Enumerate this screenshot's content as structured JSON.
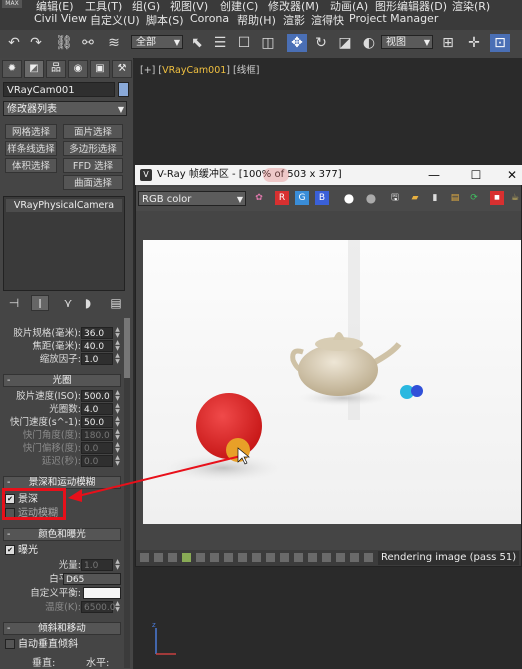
{
  "menubar": {
    "logo": "MAX",
    "row1": [
      "编辑(E)",
      "工具(T)",
      "组(G)",
      "视图(V)",
      "创建(C)",
      "修改器(M)",
      "动画(A)",
      "图形编辑器(D)",
      "渲染(R)"
    ],
    "row2": [
      "Civil View",
      "自定义(U)",
      "脚本(S)",
      "Corona",
      "帮助(H)",
      "渲影",
      "渲得快",
      "Project Manager"
    ]
  },
  "toolbar": {
    "filter_value": "全部",
    "view_value": "视图"
  },
  "panel": {
    "object_name": "VRayCam001",
    "modifier_list": "修改器列表",
    "modifier_buttons": [
      "网格选择",
      "面片选择",
      "样条线选择",
      "多边形选择",
      "体积选择",
      "FFD 选择",
      "曲面选择"
    ],
    "stack_item": "VRayPhysicalCamera",
    "sensor": {
      "film_width_label": "胶片规格(毫米):",
      "film_width_value": "36.0",
      "focal_label": "焦距(毫米):",
      "focal_value": "40.0",
      "zoom_label": "缩放因子:",
      "zoom_value": "1.0"
    },
    "aperture": {
      "title": "光圈",
      "iso_label": "胶片速度(ISO):",
      "iso_value": "500.0",
      "fnum_label": "光圈数:",
      "fnum_value": "4.0",
      "shutter_label": "快门速度(s^-1):",
      "shutter_value": "50.0",
      "shutter_angle_label": "快门角度(度):",
      "shutter_angle_value": "180.0",
      "shutter_offset_label": "快门偏移(度):",
      "shutter_offset_value": "0.0",
      "latency_label": "延迟(秒):",
      "latency_value": "0.0"
    },
    "dof": {
      "title": "景深和运动模糊",
      "dof_label": "景深",
      "motion_blur_label": "运动模糊"
    },
    "color": {
      "title": "颜色和曝光",
      "exposure_label": "曝光",
      "light_label": "光量:",
      "light_value": "1.0",
      "wb_label": "白平衡:",
      "wb_value": "D65",
      "custom_wb_label": "自定义平衡:",
      "temp_label": "温度(K):",
      "temp_value": "6500.0"
    },
    "tilt": {
      "title": "倾斜和移动",
      "auto_tilt_label": "自动垂直倾斜",
      "vertical_label": "垂直:",
      "horizontal_label": "水平:"
    }
  },
  "viewport": {
    "label_prefix": "[+] [",
    "label_cam": "VRayCam001",
    "label_suffix": "] [线框]"
  },
  "vray": {
    "title": "V-Ray 帧缓冲区 - [100% of 503 x 377]",
    "channel": "RGB color",
    "status": "Rendering image (pass 51)"
  },
  "colors": {
    "red_box": "#e8101a",
    "red_ball": "#e8242a",
    "accent": "#4a6fb5"
  }
}
